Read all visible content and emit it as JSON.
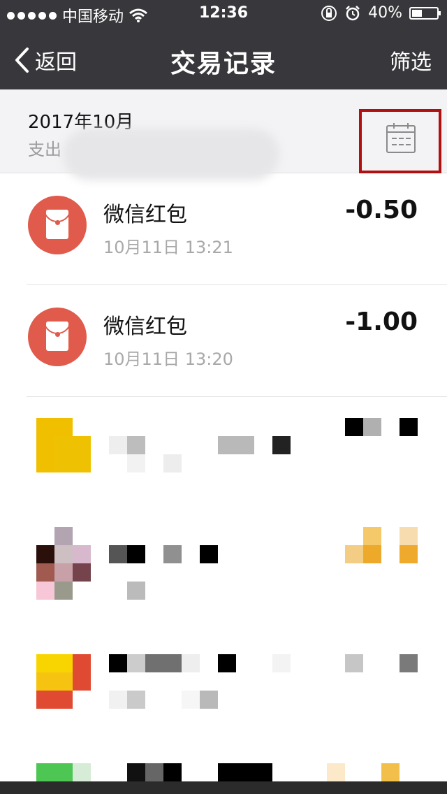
{
  "status_bar": {
    "carrier": "中国移动",
    "time": "12:36",
    "battery": "40%"
  },
  "nav": {
    "back_label": "返回",
    "title": "交易记录",
    "filter_label": "筛选"
  },
  "month_header": {
    "month": "2017年10月",
    "subtitle": "支出"
  },
  "transactions": [
    {
      "title": "微信红包",
      "time": "10月11日 13:21",
      "amount": "-0.50"
    },
    {
      "title": "微信红包",
      "time": "10月11日 13:20",
      "amount": "-1.00"
    }
  ],
  "icons": [
    "back-chevron-icon",
    "wifi-icon",
    "lock-rotation-icon",
    "alarm-icon",
    "battery-icon",
    "calendar-icon",
    "red-envelope-icon"
  ],
  "colors": {
    "nav_bg": "#38383c",
    "red_envelope": "#e05b4b",
    "highlight_border": "#b01010"
  }
}
